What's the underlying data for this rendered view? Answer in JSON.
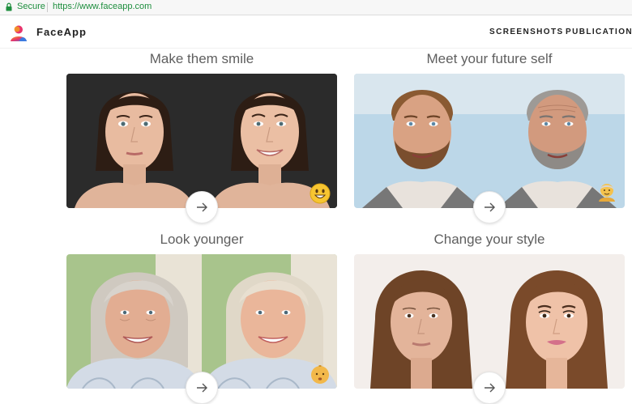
{
  "browser": {
    "secure_label": "Secure",
    "url": "https://www.faceapp.com"
  },
  "header": {
    "brand": "FaceApp",
    "nav": [
      "SCREENSHOTS",
      "PUBLICATIONS"
    ]
  },
  "features": [
    {
      "title": "Make them smile",
      "badge_icon": "smiling-emoji-icon"
    },
    {
      "title": "Meet your future self",
      "badge_icon": "old-man-emoji-icon"
    },
    {
      "title": "Look younger",
      "badge_icon": "baby-emoji-icon"
    },
    {
      "title": "Change your style",
      "badge_icon": ""
    }
  ],
  "colors": {
    "secure_green": "#1e8e3e",
    "title_gray": "#5f5f5f"
  }
}
